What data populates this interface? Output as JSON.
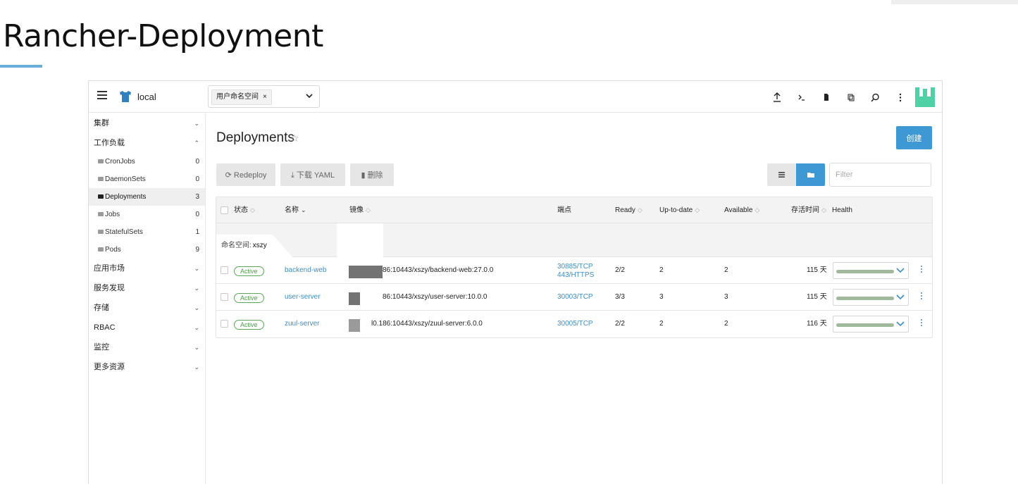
{
  "slide": {
    "title": "Rancher-Deployment"
  },
  "topbar": {
    "cluster_name": "local",
    "ns_chip": "用户命名空间",
    "ns_chip_remove": "×",
    "icons": [
      "upload-icon",
      "shell-icon",
      "file-icon",
      "copy-icon",
      "search-icon",
      "kebab-icon"
    ]
  },
  "sidebar": {
    "groups": [
      {
        "label": "集群",
        "chev": "⌄"
      },
      {
        "label": "工作负载",
        "chev": "⌃"
      },
      {
        "label": "应用市场",
        "chev": "⌄"
      },
      {
        "label": "服务发现",
        "chev": "⌄"
      },
      {
        "label": "存储",
        "chev": "⌄"
      },
      {
        "label": "RBAC",
        "chev": "⌄"
      },
      {
        "label": "监控",
        "chev": "⌄"
      },
      {
        "label": "更多资源",
        "chev": "⌄"
      }
    ],
    "items": [
      {
        "label": "CronJobs",
        "count": "0"
      },
      {
        "label": "DaemonSets",
        "count": "0"
      },
      {
        "label": "Deployments",
        "count": "3"
      },
      {
        "label": "Jobs",
        "count": "0"
      },
      {
        "label": "StatefulSets",
        "count": "1"
      },
      {
        "label": "Pods",
        "count": "9"
      }
    ]
  },
  "main": {
    "title": "Deployments",
    "star": "☆",
    "create_label": "创建",
    "redeploy_label": "Redeploy",
    "yaml_label": "下载 YAML",
    "delete_label": "删除",
    "filter_placeholder": "Filter"
  },
  "table": {
    "headers": {
      "state": "状态",
      "name": "名称",
      "image": "镜像",
      "endpoints": "端点",
      "ready": "Ready",
      "uptodate": "Up-to-date",
      "available": "Available",
      "age": "存活时间",
      "health": "Health"
    },
    "group_label": "命名空间:",
    "group_value": "xszy",
    "rows": [
      {
        "state": "Active",
        "name": "backend-web",
        "image": "86:10443/xszy/backend-web:27.0.0",
        "endpoint1": "30885/TCP",
        "endpoint2": "443/HTTPS",
        "ready": "2/2",
        "uptodate": "2",
        "available": "2",
        "age": "115 天",
        "health": 1.0
      },
      {
        "state": "Active",
        "name": "user-server",
        "image": "86:10443/xszy/user-server:10.0.0",
        "endpoint1": "30003/TCP",
        "endpoint2": "",
        "ready": "3/3",
        "uptodate": "3",
        "available": "3",
        "age": "115 天",
        "health": 1.0
      },
      {
        "state": "Active",
        "name": "zuul-server",
        "image": "l0.186:10443/xszy/zuul-server:6.0.0",
        "endpoint1": "30005/TCP",
        "endpoint2": "",
        "ready": "2/2",
        "uptodate": "2",
        "available": "2",
        "age": "116 天",
        "health": 1.0
      }
    ]
  },
  "colors": {
    "accent": "#3d98d3",
    "active": "#4b9a48",
    "health": "#9fb99a",
    "link": "#3d8dc6"
  }
}
